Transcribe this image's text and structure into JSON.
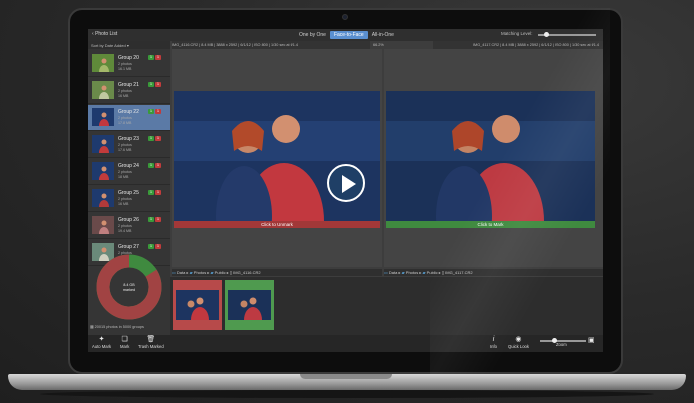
{
  "topbar": {
    "back_label": "Photo List",
    "modes": [
      "One by One",
      "Face-to-Face",
      "All-in-One"
    ],
    "active_mode": 1,
    "matching_label": "Matching Level:"
  },
  "sidebar": {
    "sort_label": "Sort by Date Added",
    "groups": [
      {
        "title": "Group 20",
        "photos": "2 photos",
        "size": "16.1 MB",
        "green": "1",
        "red": "1"
      },
      {
        "title": "Group 21",
        "photos": "2 photos",
        "size": "16 MB",
        "green": "1",
        "red": "1"
      },
      {
        "title": "Group 22",
        "photos": "2 photos",
        "size": "17.8 MB",
        "green": "1",
        "red": "1"
      },
      {
        "title": "Group 23",
        "photos": "2 photos",
        "size": "17.6 MB",
        "green": "1",
        "red": "1"
      },
      {
        "title": "Group 24",
        "photos": "2 photos",
        "size": "18 MB",
        "green": "1",
        "red": "1"
      },
      {
        "title": "Group 25",
        "photos": "2 photos",
        "size": "16 MB",
        "green": "1",
        "red": "1"
      },
      {
        "title": "Group 26",
        "photos": "2 photos",
        "size": "19.4 MB",
        "green": "1",
        "red": "1"
      },
      {
        "title": "Group 27",
        "photos": "2 photos",
        "size": "15 MB",
        "green": "1",
        "red": "1"
      }
    ],
    "donut": {
      "marked_fraction": 0.84,
      "label_size": "8.4 GB",
      "label_text": "marked",
      "marked_color": "#a14343",
      "unmarked_color": "#3f8a3f"
    },
    "stats": "20015 photos in 5000 groups"
  },
  "left_info": "IMG_4116.CR2 | 8.4 MB | 3888 x 2592 | 6/1/12 | ISO 800 | 1/30 sec at f/1.4",
  "ratio_label": "66.2%",
  "right_info": "IMG_4117.CR2 | 8.4 MB | 3888 x 2592 | 6/1/12 | ISO 800 | 1/30 sec at f/1.4",
  "left_caption": "Click to Unmark",
  "right_caption": "Click to Mark",
  "left_path": [
    "Data",
    "Photos",
    "Public",
    "IMG_4116.CR2"
  ],
  "right_path": [
    "Data",
    "Photos",
    "Public",
    "IMG_4117.CR2"
  ],
  "toolbar": {
    "auto_mark": "Auto Mark",
    "mark": "Mark",
    "trash_marked": "Trash Marked",
    "info": "Info",
    "quick_look": "Quick Look",
    "zoom": "Zoom"
  },
  "colors": {
    "accent": "#5a8fd0",
    "marked": "#a23838",
    "kept": "#3f8a3f"
  }
}
